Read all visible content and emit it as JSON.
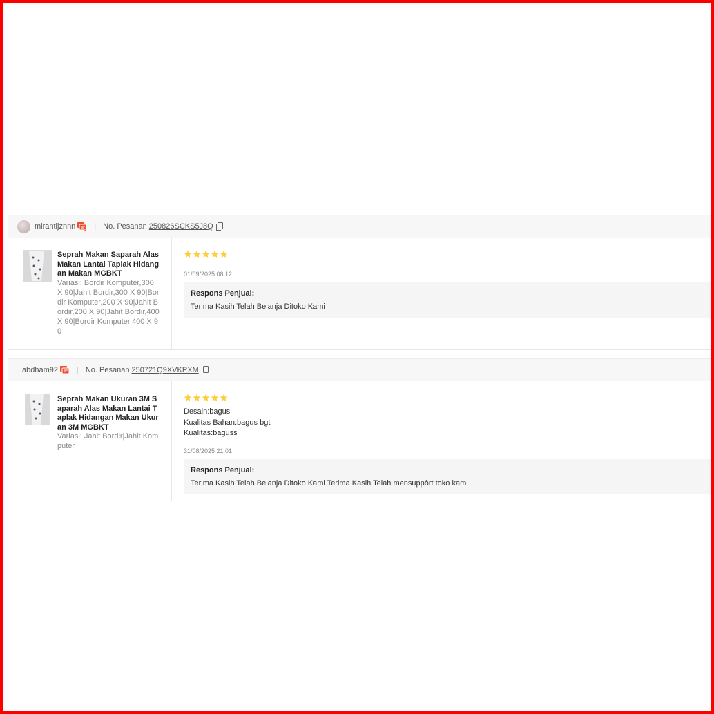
{
  "reviews": [
    {
      "username": "mirantijznnn",
      "order_label": "No. Pesanan",
      "order_number": "250826SCKS5J8Q",
      "product_name": "Seprah Makan Saparah Alas Makan Lantai Taplak Hidangan Makan MGBKT",
      "variation": "Variasi: Bordir Komputer,300 X 90|Jahit Bordir,300 X 90|Bordir Komputer,200 X 90|Jahit Bordir,200 X 90|Jahit Bordir,400 X 90|Bordir Komputer,400 X 90",
      "rating": 5,
      "comment_lines": [],
      "date": "01/09/2025 08:12",
      "response_title": "Respons Penjual:",
      "response_text": "Terima Kasih Telah Belanja Ditoko Kami"
    },
    {
      "username": "abdham92",
      "order_label": "No. Pesanan",
      "order_number": "250721Q9XVKPXM",
      "product_name": "Seprah Makan Ukuran 3M Saparah Alas Makan Lantai Taplak Hidangan Makan Ukuran 3M MGBKT",
      "variation": "Variasi: Jahit Bordir|Jahit Komputer",
      "rating": 5,
      "comment_lines": [
        "Desain:bagus",
        "Kualitas Bahan:bagus bgt",
        "Kualitas:baguss"
      ],
      "date": "31/08/2025 21:01",
      "response_title": "Respons Penjual:",
      "response_text": "Terima Kasih Telah Belanja Ditoko Kami Terima Kasih Telah mensuppòrt toko kami"
    }
  ],
  "icons": {
    "chat": "chat-bubble-icon",
    "copy": "copy-icon",
    "star": "star-icon",
    "avatar": "avatar"
  },
  "colors": {
    "accent": "#ee4d2d",
    "star": "#ffce3d",
    "frame": "#ff0000"
  }
}
